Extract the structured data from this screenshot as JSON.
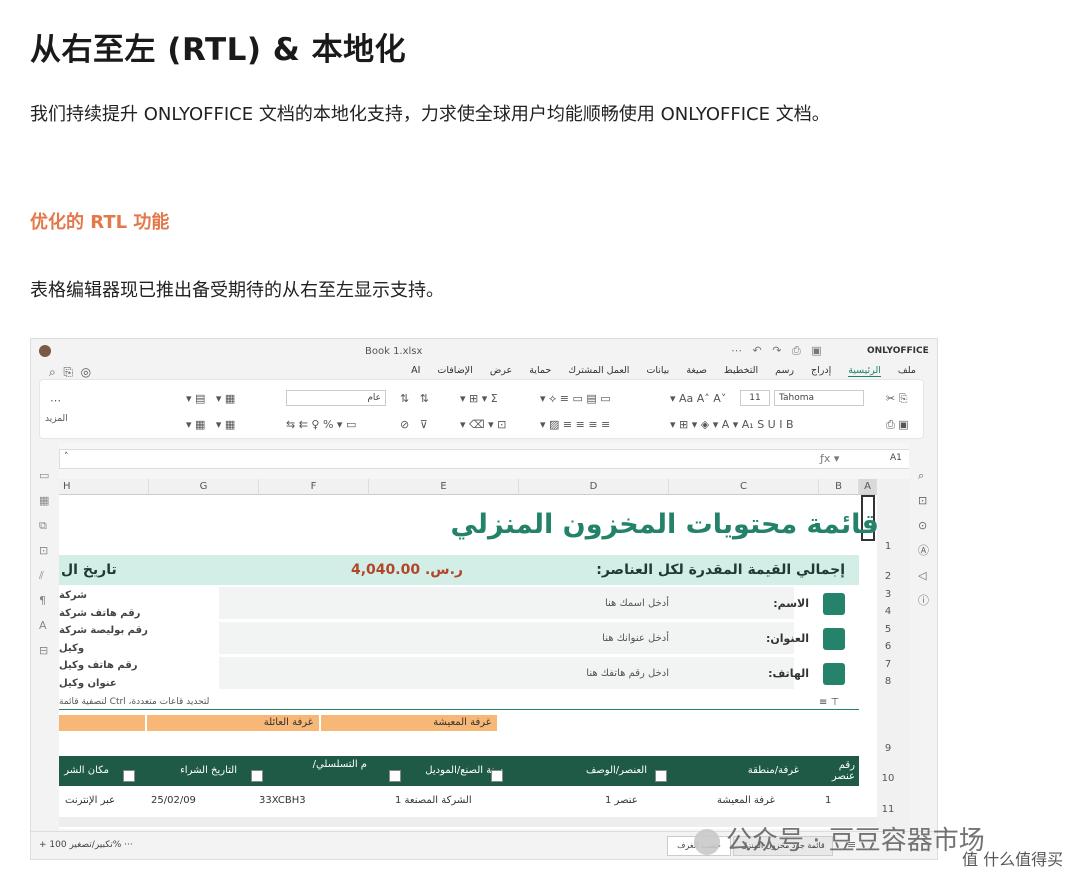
{
  "article": {
    "heading": "从右至左 (RTL) & 本地化",
    "intro": "我们持续提升 ONLYOFFICE 文档的本地化支持，力求使全球用户均能顺畅使用 ONLYOFFICE 文档。",
    "subheading": "优化的 RTL 功能",
    "body": "表格编辑器现已推出备受期待的从右至左显示支持。"
  },
  "colors": {
    "accent": "#e4784a",
    "sheet_green": "#24826a",
    "band": "#d3eee6",
    "header_dark": "#1f5a47",
    "orange": "#f7b877"
  },
  "screenshot": {
    "file_name": "Book 1.xlsx",
    "brand": "ONLYOFFICE",
    "menu_tabs": [
      "ملف",
      "الرئيسية",
      "إدراج",
      "رسم",
      "التخطيط",
      "صيغة",
      "بيانات",
      "العمل المشترك",
      "حماية",
      "عرض",
      "الإضافات",
      "AI"
    ],
    "font_name": "Tahoma",
    "font_size": "11",
    "number_format": "عام",
    "more_label": "المزيد",
    "cell_ref": "A1",
    "columns": [
      "A",
      "B",
      "C",
      "D",
      "E",
      "F",
      "G",
      "H"
    ],
    "rows": [
      "1",
      "2",
      "3",
      "4",
      "5",
      "6",
      "7",
      "8",
      "9",
      "10",
      "11"
    ],
    "title": "قائمة محتويات المخزون المنزلي",
    "total_label": "إجمالي القيمة المقدرة لكل العناصر:",
    "total_value": "ر.س. 4,040.00",
    "date_label": "تاريخ ال",
    "fields": [
      {
        "label": "الاسم:",
        "placeholder": "أدخل اسمك هنا"
      },
      {
        "label": "العنوان:",
        "placeholder": "أدخل عنوانك هنا"
      },
      {
        "label": "الهاتف:",
        "placeholder": "ادخل رقم هاتفك هنا"
      }
    ],
    "side_notes": [
      "شركة",
      "رقم هاتف شركة",
      "رقم بوليصة شركة",
      "وكيل",
      "رقم هاتف وكيل",
      "عنوان وكيل"
    ],
    "hint": "لتحديد قاعات متعددة، Ctrl لتصفية قائمة",
    "rooms": [
      "غرفة المعيشة",
      "غرفة العائلة"
    ],
    "table_headers": [
      "رقم عنصر",
      "غرفة/منطقة",
      "العنصر/الوصف",
      "سنة الصنع/الموديل",
      "م التسلسلي/",
      "التاريخ الشراء",
      "مكان الشر"
    ],
    "row1": [
      "1",
      "غرفة المعيشة",
      "عنصر 1",
      "الشركة المصنعة 1",
      "33XCBH3",
      "25/02/09",
      "عبر الإنترنت"
    ],
    "sheet_tabs": [
      "قائمة جرد مخزون المنزل",
      "حسب الغرف"
    ],
    "zoom": "تكبير/تصغير 100%"
  },
  "watermark": {
    "channel": "公众号 · 豆豆容器市场",
    "site": "值 什么值得买"
  }
}
